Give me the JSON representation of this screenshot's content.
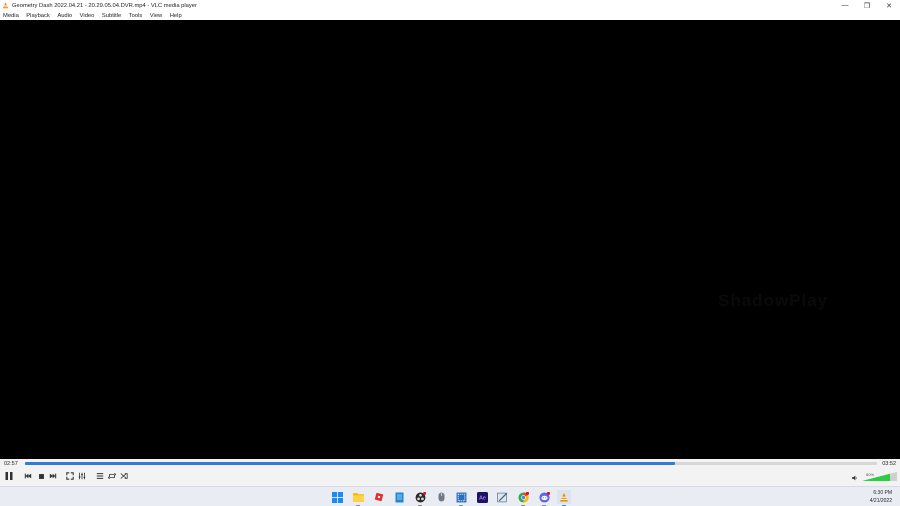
{
  "window": {
    "title": "Geometry Dash 2022.04.21 - 20.29.05.04.DVR.mp4 - VLC media player",
    "minimize_glyph": "—",
    "maximize_glyph": "❐",
    "close_glyph": "✕"
  },
  "menu": {
    "items": [
      "Media",
      "Playback",
      "Audio",
      "Video",
      "Subtitle",
      "Tools",
      "View",
      "Help"
    ]
  },
  "video": {
    "watermark": "ShadowPlay"
  },
  "controls": {
    "time_elapsed": "02:57",
    "time_total": "03:52",
    "progress_fraction": 0.763,
    "volume_label": "80%",
    "volume_fraction": 0.8,
    "accent_color": "#2f7bd6",
    "volume_color": "#2ecc40"
  },
  "taskbar": {
    "clock_time": "6:30 PM",
    "clock_date": "4/21/2022",
    "apps": [
      {
        "name": "windows-start",
        "color": "#1a8cf0"
      },
      {
        "name": "file-explorer",
        "color": "#f5b900"
      },
      {
        "name": "roblox",
        "color": "#e0302d"
      },
      {
        "name": "notepad",
        "color": "#1f86d4"
      },
      {
        "name": "obs",
        "color": "#2a2a2a"
      },
      {
        "name": "mouse-app",
        "color": "#6f7a8a"
      },
      {
        "name": "snipping-tool",
        "color": "#2b6fb8"
      },
      {
        "name": "after-effects",
        "color": "#1b1464"
      },
      {
        "name": "paint",
        "color": "#4a6a8a"
      },
      {
        "name": "chrome",
        "color": "#34a853"
      },
      {
        "name": "discord",
        "color": "#5865f2"
      },
      {
        "name": "vlc",
        "color": "#f08a00"
      }
    ]
  }
}
